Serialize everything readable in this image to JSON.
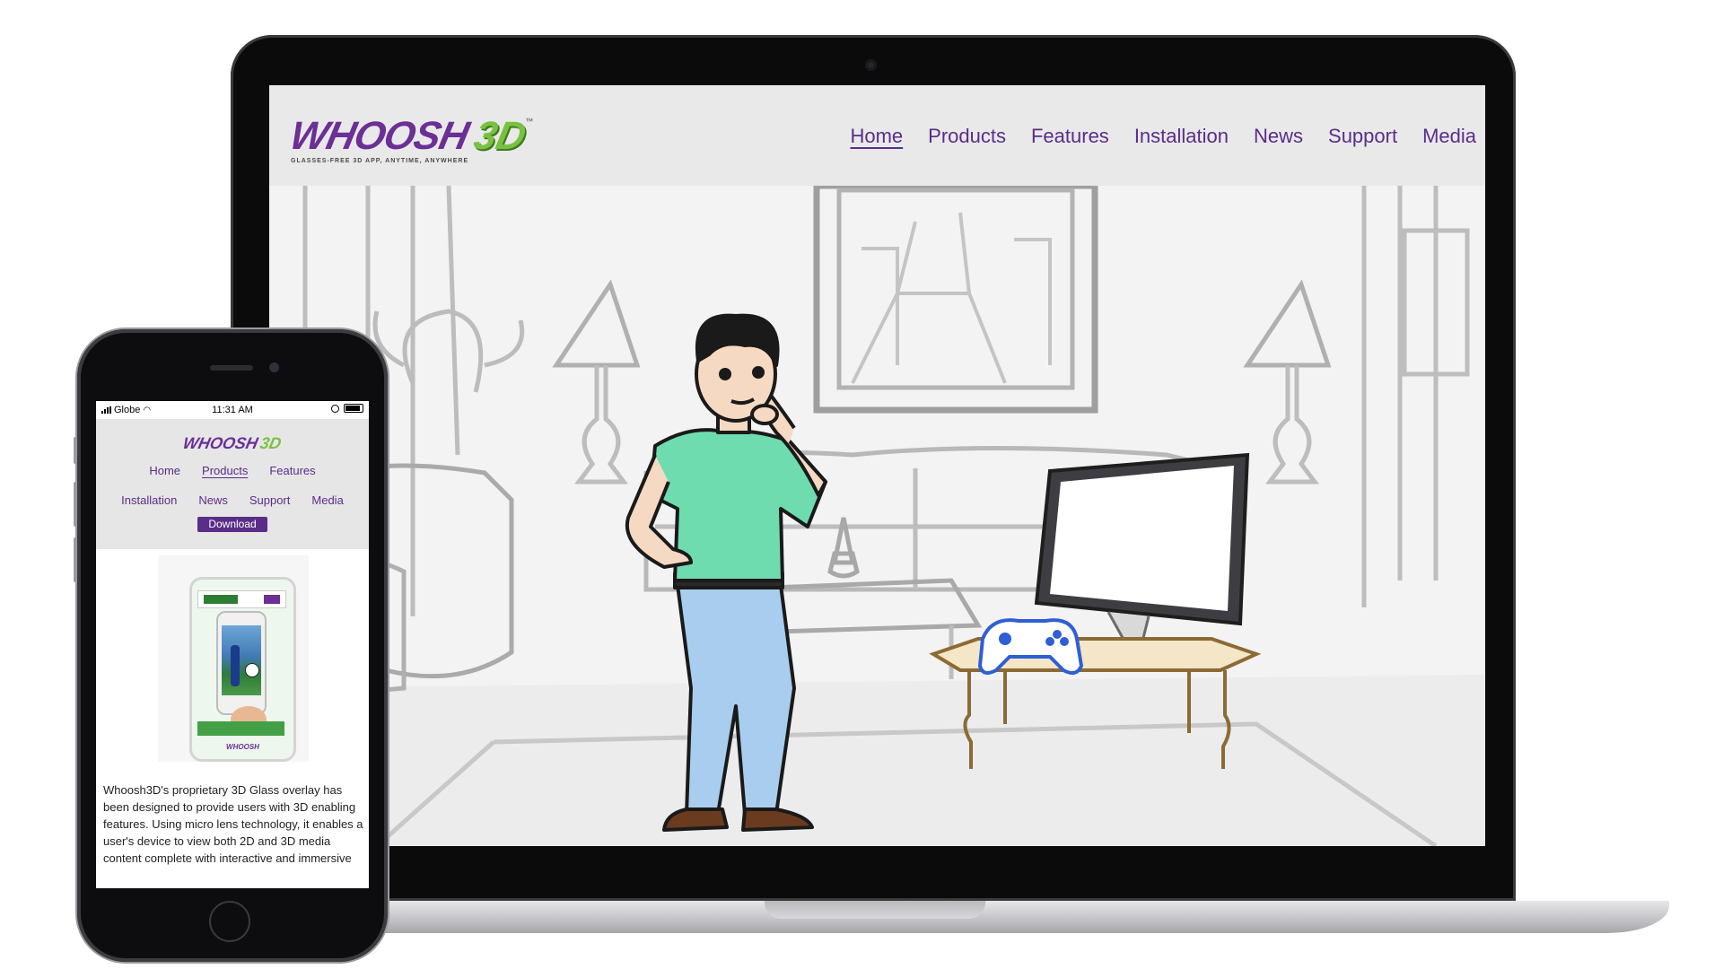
{
  "desktop": {
    "logo": {
      "word": "WHOOSH",
      "mark": "3D",
      "tm": "™",
      "tagline": "GLASSES-FREE 3D APP, ANYTIME, ANYWHERE"
    },
    "nav": [
      "Home",
      "Products",
      "Features",
      "Installation",
      "News",
      "Support",
      "Media"
    ],
    "active_nav": "Home"
  },
  "mobile": {
    "status": {
      "carrier": "Globe",
      "time": "11:31 AM"
    },
    "logo": {
      "word": "WHOOSH",
      "mark": "3D"
    },
    "nav_row1": [
      "Home",
      "Products",
      "Features"
    ],
    "nav_row2": [
      "Installation",
      "News",
      "Support",
      "Media"
    ],
    "active_nav": "Products",
    "download_label": "Download",
    "description": "Whoosh3D's proprietary 3D Glass overlay has been designed to provide users with 3D enabling features. Using micro lens technology, it enables a user's device to view both 2D and 3D media content complete with interactive and immersive"
  },
  "colors": {
    "brand_purple": "#5a2d88",
    "brand_green": "#7ac142",
    "shirt": "#6fdcb0",
    "jeans": "#a9cdee",
    "controller": "#2f5fd6"
  }
}
